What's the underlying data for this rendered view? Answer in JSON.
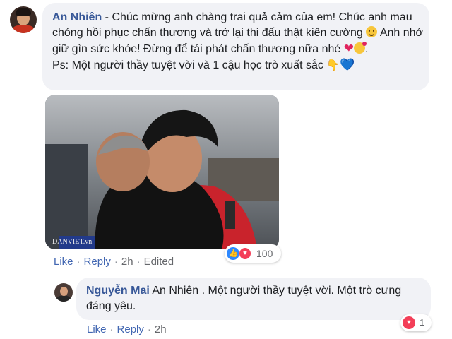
{
  "comment1": {
    "author": "An Nhiên",
    "text_part1": " - Chúc mừng anh chàng trai quả cảm của em! Chúc anh mau chóng hồi phục chấn thương và trở lại thi đấu thật kiên cường ",
    "text_part2": " Anh nhớ giữ gìn sức khỏe! Đừng để tái phát chấn thương nữa nhé ",
    "text_part3": ".",
    "ps_text": "Ps: Một người thầy tuyệt vời và 1 cậu học trò xuất sắc ",
    "photo_watermark": "DANVIET.vn",
    "reaction_count": "100",
    "actions": {
      "like": "Like",
      "reply": "Reply",
      "time": "2h",
      "edited": "Edited"
    }
  },
  "reply1": {
    "author": "Nguyễn Mai",
    "mention": "An Nhiên",
    "text": " . Một người thầy tuyệt vời. Một trò cưng đáng yêu.",
    "reaction_count": "1",
    "actions": {
      "like": "Like",
      "reply": "Reply",
      "time": "2h"
    }
  },
  "icons": {
    "smile": "smiling-face-icon",
    "heart": "red-heart-icon",
    "kiss": "face-blowing-kiss-icon",
    "point_down": "backhand-pointing-down-icon",
    "blue_heart": "blue-heart-icon",
    "like": "like-reaction-icon",
    "love": "love-reaction-icon"
  },
  "colors": {
    "author_link": "#385898",
    "action_link": "#4267b2",
    "bubble_bg": "#f1f2f6",
    "like_blue": "#2d88ff",
    "love_red": "#f33e58"
  }
}
